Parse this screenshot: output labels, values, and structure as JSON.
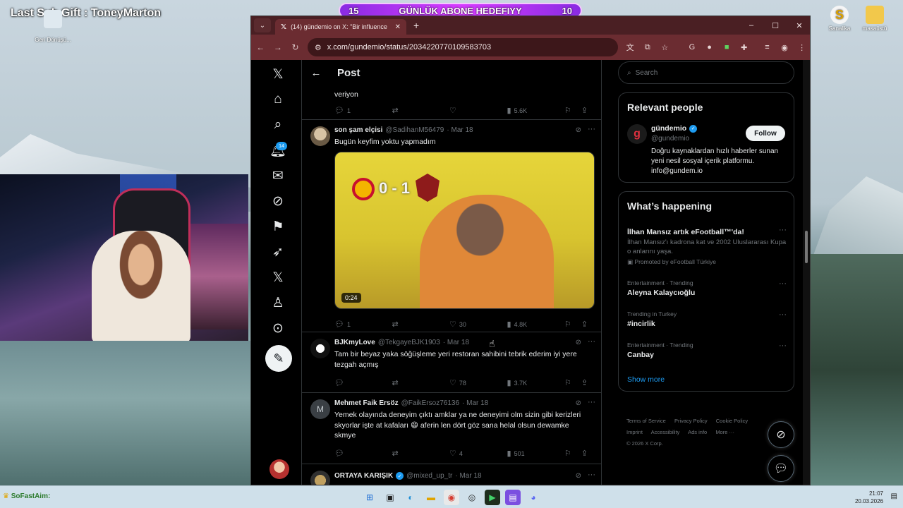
{
  "overlay": {
    "stream_title": "Last Sub Gift : ToneyMarton",
    "sub_goal_left": "15",
    "sub_goal_label": "GÜNLÜK ABONE HEDEFIYY",
    "sub_goal_right": "10"
  },
  "desktop": {
    "left_icon_label": "Geri Dönüşü...",
    "right_icons": [
      {
        "label": "Sanalika",
        "icon": "sanalika-icon"
      },
      {
        "label": "masaüstü",
        "icon": "folder-icon"
      }
    ]
  },
  "browser": {
    "tab_title": "(14) gündemio on X: \"Bir influence",
    "url": "x.com/gundemio/status/2034220770109583703",
    "window_controls": [
      "–",
      "☐",
      "✕"
    ]
  },
  "x": {
    "page_title": "Post",
    "notification_count": "14",
    "tweets": [
      {
        "body": "veriyon",
        "replies": "1",
        "retweets": "",
        "likes": "",
        "views": "5.6K"
      },
      {
        "name": "son şam elçisi",
        "handle": "@SadihanM56479",
        "date": "· Mar 18",
        "body": "Bugün keyfim yoktu yapmadım",
        "media_score": "0 - 1",
        "media_duration": "0:24",
        "replies": "1",
        "retweets": "",
        "likes": "30",
        "views": "4.8K"
      },
      {
        "name": "BJKmyLove",
        "handle": "@TekgayeBJK1903",
        "date": "· Mar 18",
        "body": "Tam bir beyaz yaka söğüşleme yeri restoran sahibini tebrik ederim iyi yere tezgah açmış",
        "replies": "",
        "retweets": "",
        "likes": "78",
        "views": "3.7K"
      },
      {
        "name": "Mehmet Faik Ersöz",
        "handle": "@FaikErsoz76136",
        "date": "· Mar 18",
        "avatar_letter": "M",
        "body": "Yemek olayında deneyim çıktı amklar ya ne deneyimi olm sizin gibi kerizleri skyorlar işte at kafaları 😄 aferin len dört göz sana helal olsun dewamke skmye",
        "replies": "",
        "retweets": "",
        "likes": "4",
        "views": "501"
      },
      {
        "name": "ORTAYA KARIŞIK",
        "handle": "@mixed_up_tr",
        "date": "· Mar 18"
      }
    ],
    "search_placeholder": "Search",
    "relevant_people": {
      "title": "Relevant people",
      "name": "gündemio",
      "handle": "@gundemio",
      "follow_label": "Follow",
      "bio": "Doğru kaynaklardan hızlı haberler sunan yeni nesil sosyal içerik platformu. info@gundem.io"
    },
    "whats_happening": {
      "title": "What’s happening",
      "trends": [
        {
          "category": "",
          "title": "İlhan Mansız artık eFootball™'da!",
          "desc": "İlhan Mansız'ı kadrona kat ve 2002 Uluslararası Kupa o anlarını yaşa.",
          "promo": "Promoted by eFootball Türkiye"
        },
        {
          "category": "Entertainment · Trending",
          "title": "Aleyna Kalaycıoğlu"
        },
        {
          "category": "Trending in Turkey",
          "title": "#incirlik"
        },
        {
          "category": "Entertainment · Trending",
          "title": "Canbay"
        }
      ],
      "show_more": "Show more"
    },
    "footer": {
      "links": [
        "Terms of Service",
        "Privacy Policy",
        "Cookie Policy",
        "Imprint",
        "Accessibility",
        "Ads info",
        "More ···"
      ],
      "copyright": "© 2026 X Corp."
    }
  },
  "taskbar": {
    "left_text": "SoFastAim:",
    "time": "21:07",
    "date": "20.03.2026"
  }
}
